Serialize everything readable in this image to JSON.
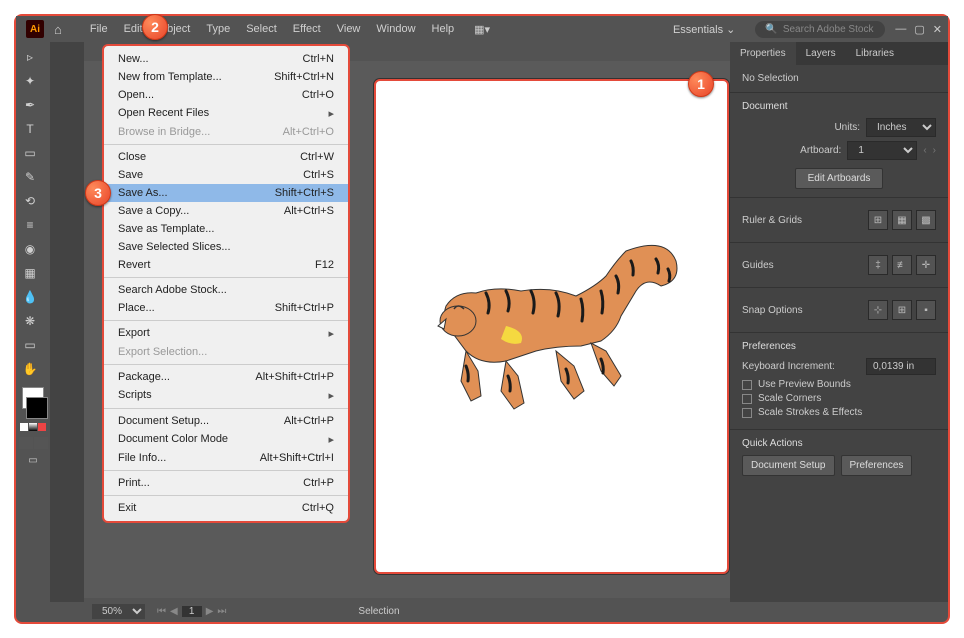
{
  "app": {
    "logo": "Ai"
  },
  "menubar": [
    "File",
    "Edit",
    "Object",
    "Type",
    "Select",
    "Effect",
    "View",
    "Window",
    "Help"
  ],
  "workspace": {
    "label": "Essentials"
  },
  "search": {
    "placeholder": "Search Adobe Stock"
  },
  "file_menu": [
    {
      "label": "New...",
      "shortcut": "Ctrl+N"
    },
    {
      "label": "New from Template...",
      "shortcut": "Shift+Ctrl+N"
    },
    {
      "label": "Open...",
      "shortcut": "Ctrl+O"
    },
    {
      "label": "Open Recent Files",
      "sub": true
    },
    {
      "label": "Browse in Bridge...",
      "shortcut": "Alt+Ctrl+O",
      "disabled": true
    },
    {
      "sep": true
    },
    {
      "label": "Close",
      "shortcut": "Ctrl+W"
    },
    {
      "label": "Save",
      "shortcut": "Ctrl+S"
    },
    {
      "label": "Save As...",
      "shortcut": "Shift+Ctrl+S",
      "selected": true
    },
    {
      "label": "Save a Copy...",
      "shortcut": "Alt+Ctrl+S"
    },
    {
      "label": "Save as Template..."
    },
    {
      "label": "Save Selected Slices..."
    },
    {
      "label": "Revert",
      "shortcut": "F12"
    },
    {
      "sep": true
    },
    {
      "label": "Search Adobe Stock..."
    },
    {
      "label": "Place...",
      "shortcut": "Shift+Ctrl+P"
    },
    {
      "sep": true
    },
    {
      "label": "Export",
      "sub": true
    },
    {
      "label": "Export Selection...",
      "disabled": true
    },
    {
      "sep": true
    },
    {
      "label": "Package...",
      "shortcut": "Alt+Shift+Ctrl+P"
    },
    {
      "label": "Scripts",
      "sub": true
    },
    {
      "sep": true
    },
    {
      "label": "Document Setup...",
      "shortcut": "Alt+Ctrl+P"
    },
    {
      "label": "Document Color Mode",
      "sub": true
    },
    {
      "label": "File Info...",
      "shortcut": "Alt+Shift+Ctrl+I"
    },
    {
      "sep": true
    },
    {
      "label": "Print...",
      "shortcut": "Ctrl+P"
    },
    {
      "sep": true
    },
    {
      "label": "Exit",
      "shortcut": "Ctrl+Q"
    }
  ],
  "panel": {
    "tabs": [
      "Properties",
      "Layers",
      "Libraries"
    ],
    "selection": "No Selection",
    "document": {
      "title": "Document",
      "units_label": "Units:",
      "units_value": "Inches",
      "artboard_label": "Artboard:",
      "artboard_value": "1",
      "edit_btn": "Edit Artboards"
    },
    "ruler_title": "Ruler & Grids",
    "guides_title": "Guides",
    "snap_title": "Snap Options",
    "prefs": {
      "title": "Preferences",
      "kb_label": "Keyboard Increment:",
      "kb_value": "0,0139 in",
      "chk1": "Use Preview Bounds",
      "chk2": "Scale Corners",
      "chk3": "Scale Strokes & Effects"
    },
    "quick": {
      "title": "Quick Actions",
      "btn1": "Document Setup",
      "btn2": "Preferences"
    }
  },
  "status": {
    "zoom": "50%",
    "page": "1",
    "mode": "Selection"
  },
  "badges": {
    "b1": "1",
    "b2": "2",
    "b3": "3"
  }
}
